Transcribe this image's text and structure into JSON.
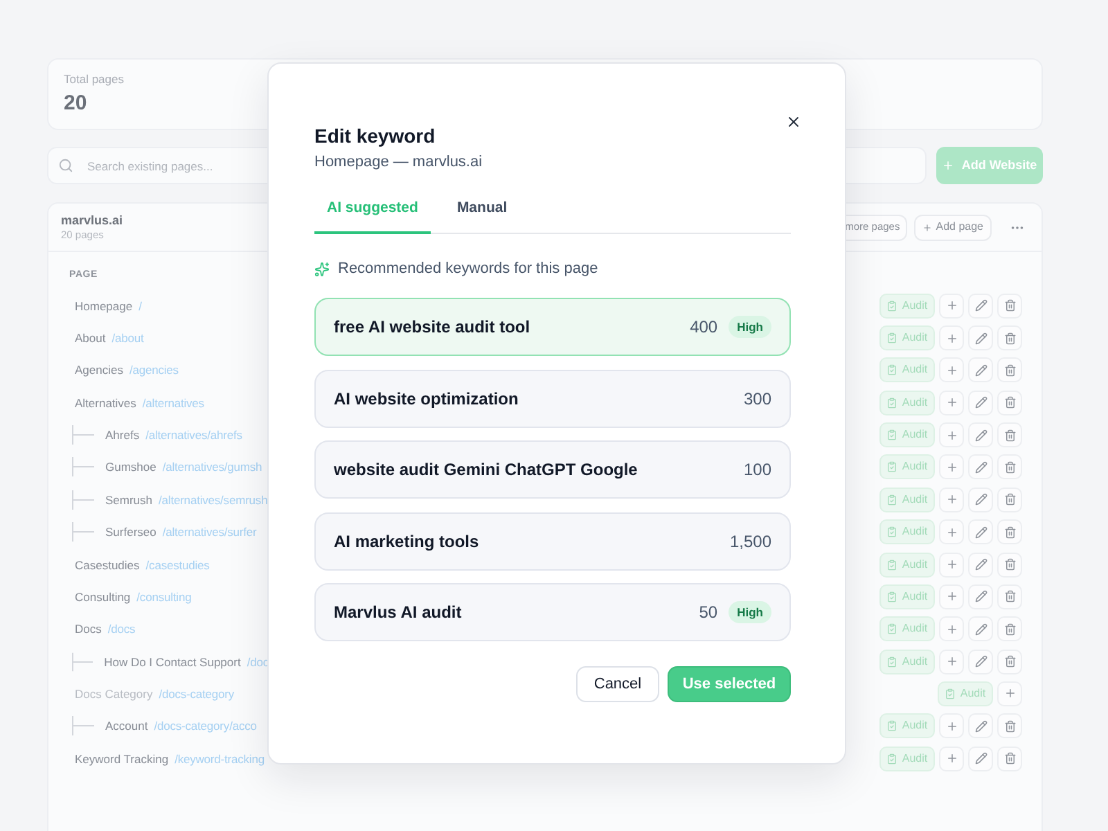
{
  "summary": {
    "label": "Total pages",
    "value": "20"
  },
  "search": {
    "placeholder": "Search existing pages..."
  },
  "add_website": {
    "label": "Add Website"
  },
  "site": {
    "name": "marvlus.ai",
    "count": "20 pages",
    "buttons": [
      {
        "label": "more pages",
        "kind": "plain"
      },
      {
        "label": "Add page",
        "kind": "add"
      }
    ]
  },
  "table": {
    "columns": [
      "PAGE"
    ],
    "rows": [
      {
        "name": "Homepage",
        "path": "/",
        "kind": "page",
        "audit": "Audit"
      },
      {
        "name": "About",
        "path": "/about",
        "kind": "page",
        "audit": "Audit"
      },
      {
        "name": "Agencies",
        "path": "/agencies",
        "kind": "page",
        "audit": "Audit"
      },
      {
        "name": "Alternatives",
        "path": "/alternatives",
        "kind": "page",
        "audit": "Audit",
        "children": [
          {
            "name": "Ahrefs",
            "path": "/alternatives/ahrefs",
            "kind": "page",
            "audit": "Audit"
          },
          {
            "name": "Gumshoe",
            "path": "/alternatives/gumsh",
            "kind": "page",
            "audit": "Audit"
          },
          {
            "name": "Semrush",
            "path": "/alternatives/semrush",
            "kind": "page",
            "audit": "Audit"
          },
          {
            "name": "Surferseo",
            "path": "/alternatives/surfer",
            "kind": "page",
            "audit": "Audit"
          }
        ]
      },
      {
        "name": "Casestudies",
        "path": "/casestudies",
        "kind": "page",
        "audit": "Audit"
      },
      {
        "name": "Consulting",
        "path": "/consulting",
        "kind": "page",
        "audit": "Audit"
      },
      {
        "name": "Docs",
        "path": "/docs",
        "kind": "page",
        "audit": "Audit",
        "children": [
          {
            "name": "How Do I Contact Support",
            "path": "/doc",
            "kind": "page",
            "audit": "Audit"
          }
        ]
      },
      {
        "name": "Docs Category",
        "path": "/docs-category",
        "kind": "category",
        "audit": "Audit",
        "children": [
          {
            "name": "Account",
            "path": "/docs-category/acco",
            "kind": "page",
            "audit": "Audit"
          }
        ]
      },
      {
        "name": "Keyword Tracking",
        "path": "/keyword-tracking",
        "kind": "page",
        "audit": "Audit"
      }
    ]
  },
  "dialog": {
    "title": "Edit keyword",
    "subtitle": "Homepage — marvlus.ai",
    "tabs": [
      {
        "label": "AI suggested",
        "selected": true
      },
      {
        "label": "Manual",
        "selected": false
      }
    ],
    "hint": "Recommended keywords for this page",
    "keywords": [
      {
        "keyword": "free AI website audit tool",
        "volume": "400",
        "badge": "High",
        "selected": true
      },
      {
        "keyword": "AI website optimization",
        "volume": "300",
        "selected": false
      },
      {
        "keyword": "website audit Gemini ChatGPT Google",
        "volume": "100",
        "selected": false
      },
      {
        "keyword": "AI marketing tools",
        "volume": "1,500",
        "selected": false
      },
      {
        "keyword": "Marvlus AI audit",
        "volume": "50",
        "badge": "High",
        "selected": false
      }
    ],
    "buttons": [
      {
        "label": "Cancel",
        "kind": "secondary"
      },
      {
        "label": "Use selected",
        "kind": "primary"
      }
    ]
  }
}
